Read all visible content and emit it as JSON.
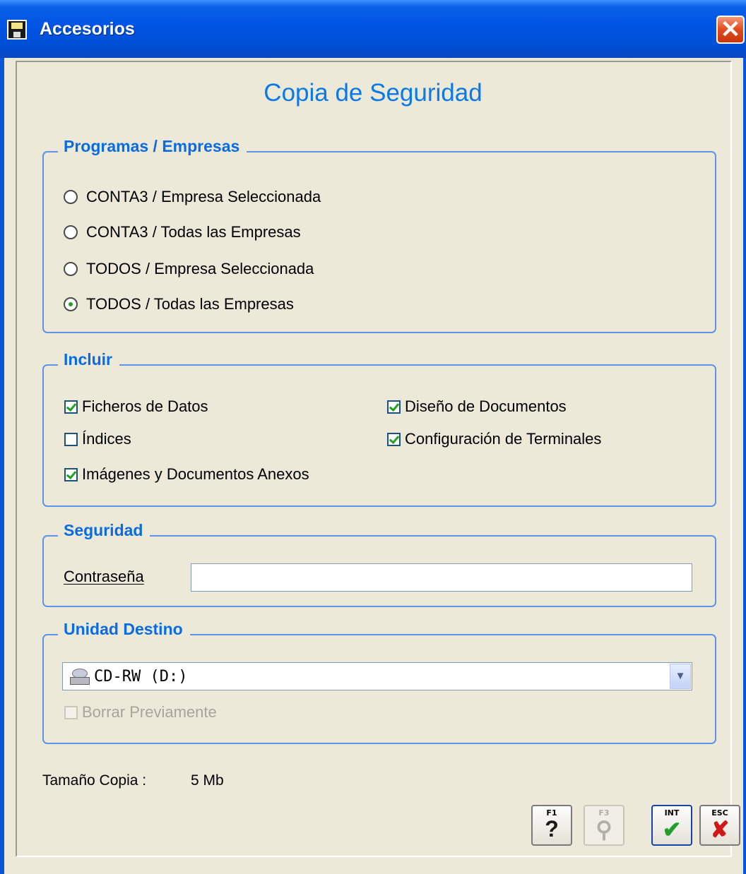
{
  "window": {
    "title": "Accesorios",
    "close_icon": "✕"
  },
  "dialog": {
    "title": "Copia de Seguridad"
  },
  "programas": {
    "legend": "Programas / Empresas",
    "options": [
      {
        "label": "CONTA3 / Empresa Seleccionada",
        "selected": false
      },
      {
        "label": "CONTA3 / Todas las Empresas",
        "selected": false
      },
      {
        "label": "TODOS / Empresa Seleccionada",
        "selected": false
      },
      {
        "label": "TODOS / Todas las Empresas",
        "selected": true
      }
    ]
  },
  "incluir": {
    "legend": "Incluir",
    "items": [
      {
        "label": "Ficheros de Datos",
        "checked": true
      },
      {
        "label": "Índices",
        "checked": false
      },
      {
        "label": "Imágenes y Documentos Anexos",
        "checked": true
      },
      {
        "label": "Diseño de Documentos",
        "checked": true
      },
      {
        "label": "Configuración de Terminales",
        "checked": true
      }
    ]
  },
  "seguridad": {
    "legend": "Seguridad",
    "password_label": "Contraseña",
    "password_value": ""
  },
  "destino": {
    "legend": "Unidad Destino",
    "selected": "CD-RW (D:)",
    "drive_icon": "cd-drive-icon",
    "dropdown_icon": "chevron-down-icon",
    "clear_label": "Borrar Previamente",
    "clear_checked": false,
    "clear_enabled": false
  },
  "size": {
    "label": "Tamaño Copia :",
    "value": "5 Mb"
  },
  "toolbar": {
    "f1": {
      "key": "F1",
      "glyph": "?",
      "icon": "help-icon"
    },
    "f3": {
      "key": "F3",
      "glyph": "⚲",
      "icon": "search-icon"
    },
    "int": {
      "key": "INT",
      "glyph": "✔",
      "icon": "accept-icon"
    },
    "esc": {
      "key": "ESC",
      "glyph": "✘",
      "icon": "cancel-icon"
    }
  },
  "colors": {
    "accent": "#0a7ae8",
    "group_border": "#5f93e9",
    "window_bg": "#ece9d8",
    "titlebar": "#0054e3"
  }
}
